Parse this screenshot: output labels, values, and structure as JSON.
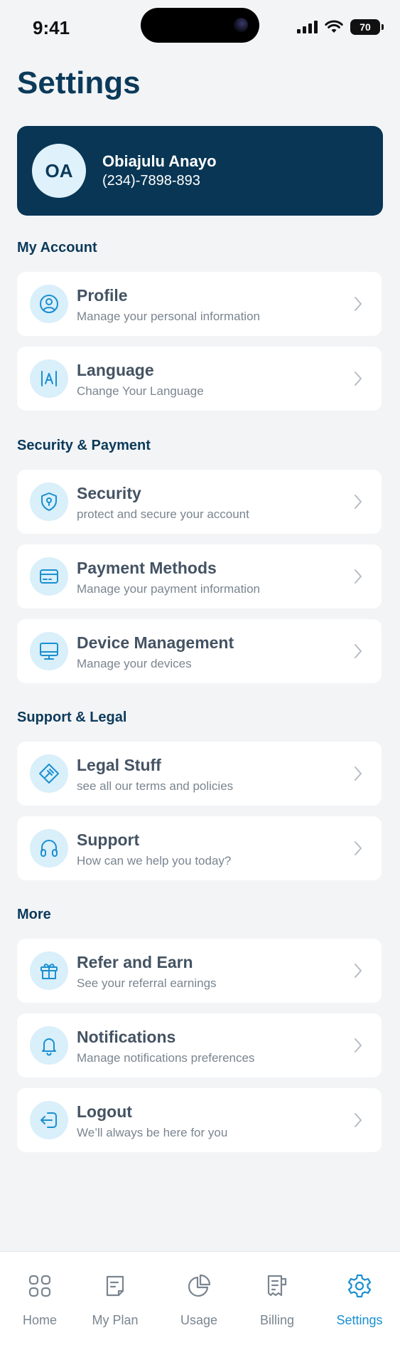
{
  "status_bar": {
    "time": "9:41",
    "battery": "70"
  },
  "page": {
    "title": "Settings"
  },
  "profile": {
    "initials": "OA",
    "name": "Obiajulu Anayo",
    "phone": "(234)-7898-893"
  },
  "sections": {
    "my_account": {
      "title": "My Account",
      "items": [
        {
          "title": "Profile",
          "subtitle": "Manage your personal information",
          "icon": "user-icon"
        },
        {
          "title": "Language",
          "subtitle": "Change Your Language",
          "icon": "language-icon"
        }
      ]
    },
    "security_payment": {
      "title": "Security & Payment",
      "items": [
        {
          "title": "Security",
          "subtitle": "protect and secure your account",
          "icon": "shield-icon"
        },
        {
          "title": "Payment Methods",
          "subtitle": "Manage your payment information",
          "icon": "card-icon"
        },
        {
          "title": "Device Management",
          "subtitle": "Manage your devices",
          "icon": "monitor-icon"
        }
      ]
    },
    "support_legal": {
      "title": "Support & Legal",
      "items": [
        {
          "title": "Legal Stuff",
          "subtitle": "see all  our terms and policies",
          "icon": "gavel-icon"
        },
        {
          "title": "Support",
          "subtitle": "How can we help you today?",
          "icon": "headphones-icon"
        }
      ]
    },
    "more": {
      "title": "More",
      "items": [
        {
          "title": "Refer and Earn",
          "subtitle": "See your referral earnings",
          "icon": "gift-icon"
        },
        {
          "title": "Notifications",
          "subtitle": "Manage notifications preferences",
          "icon": "bell-icon"
        },
        {
          "title": "Logout",
          "subtitle": "We’ll always be here for you",
          "icon": "logout-icon"
        }
      ]
    }
  },
  "tabs": [
    {
      "label": "Home",
      "icon": "grid-icon"
    },
    {
      "label": "My Plan",
      "icon": "plan-icon"
    },
    {
      "label": "Usage",
      "icon": "pie-chart-icon"
    },
    {
      "label": "Billing",
      "icon": "receipt-icon"
    },
    {
      "label": "Settings",
      "icon": "gear-icon",
      "active": true
    }
  ],
  "colors": {
    "primary": "#083654",
    "accent": "#1a8fd1",
    "icon_bg": "#d9effa",
    "background": "#f3f4f6"
  }
}
